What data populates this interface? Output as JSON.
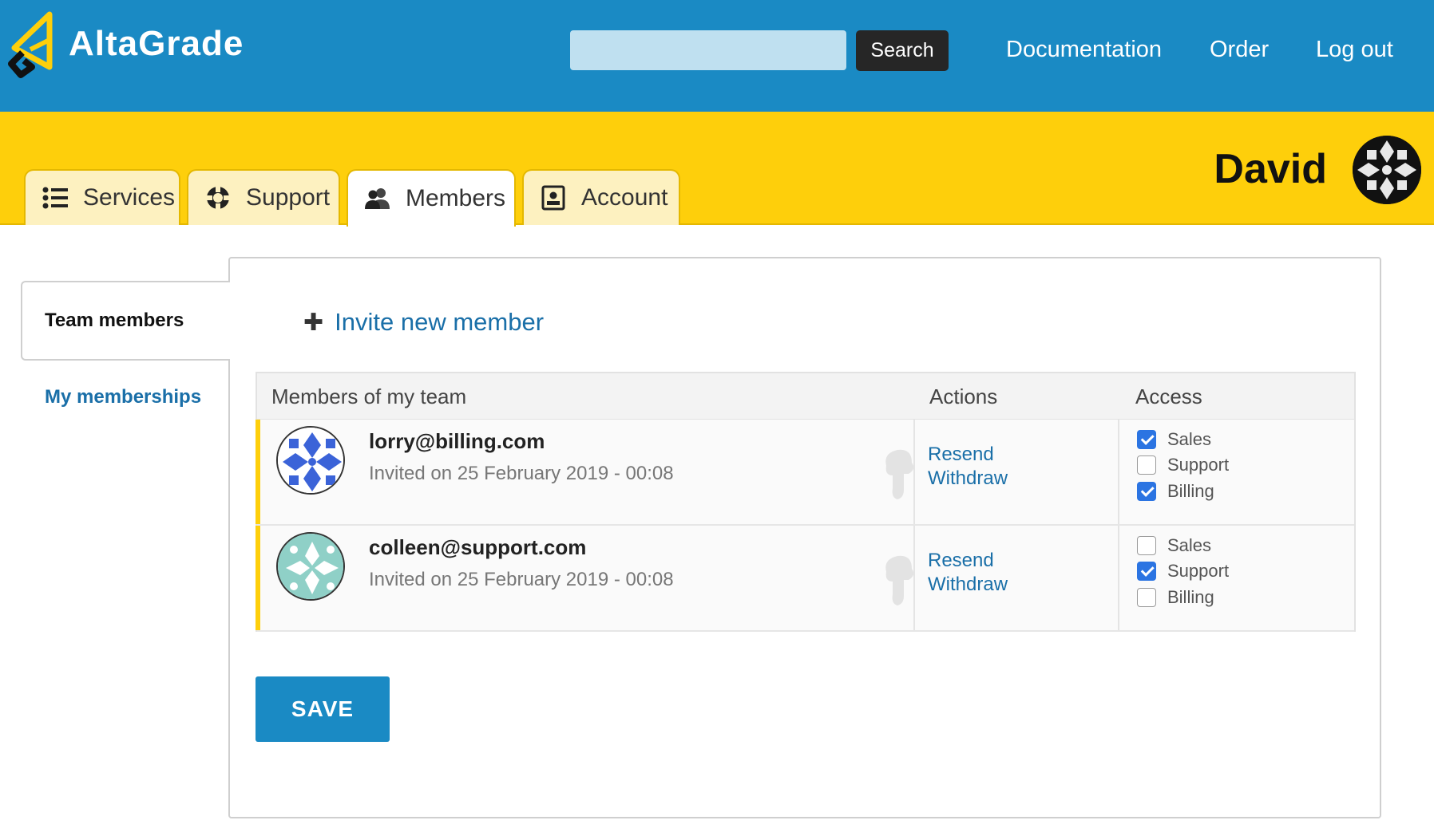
{
  "header": {
    "brand": "AltaGrade",
    "search": {
      "value": "",
      "placeholder": "",
      "button_label": "Search"
    },
    "links": [
      "Documentation",
      "Order",
      "Log out"
    ],
    "colors": {
      "topbar": "#1a8ac4",
      "band": "#fecf0b",
      "link": "#1a6fa8"
    }
  },
  "tabs": [
    {
      "label": "Services",
      "icon": "list-icon",
      "active": false
    },
    {
      "label": "Support",
      "icon": "lifebuoy-icon",
      "active": false
    },
    {
      "label": "Members",
      "icon": "users-icon",
      "active": true
    },
    {
      "label": "Account",
      "icon": "contact-card-icon",
      "active": false
    }
  ],
  "user": {
    "name": "David"
  },
  "sidebar": {
    "active_item": "Team members",
    "link_item": "My memberships"
  },
  "main": {
    "invite_label": "Invite new member",
    "table": {
      "headers": [
        "Members of my team",
        "Actions",
        "Access"
      ],
      "rows": [
        {
          "email": "lorry@billing.com",
          "invited": "Invited on 25 February 2019 - 00:08",
          "actions": [
            "Resend",
            "Withdraw"
          ],
          "access": [
            {
              "label": "Sales",
              "checked": true
            },
            {
              "label": "Support",
              "checked": false
            },
            {
              "label": "Billing",
              "checked": true
            }
          ]
        },
        {
          "email": "colleen@support.com",
          "invited": "Invited on 25 February 2019 - 00:08",
          "actions": [
            "Resend",
            "Withdraw"
          ],
          "access": [
            {
              "label": "Sales",
              "checked": false
            },
            {
              "label": "Support",
              "checked": true
            },
            {
              "label": "Billing",
              "checked": false
            }
          ]
        }
      ]
    },
    "save_label": "SAVE"
  }
}
